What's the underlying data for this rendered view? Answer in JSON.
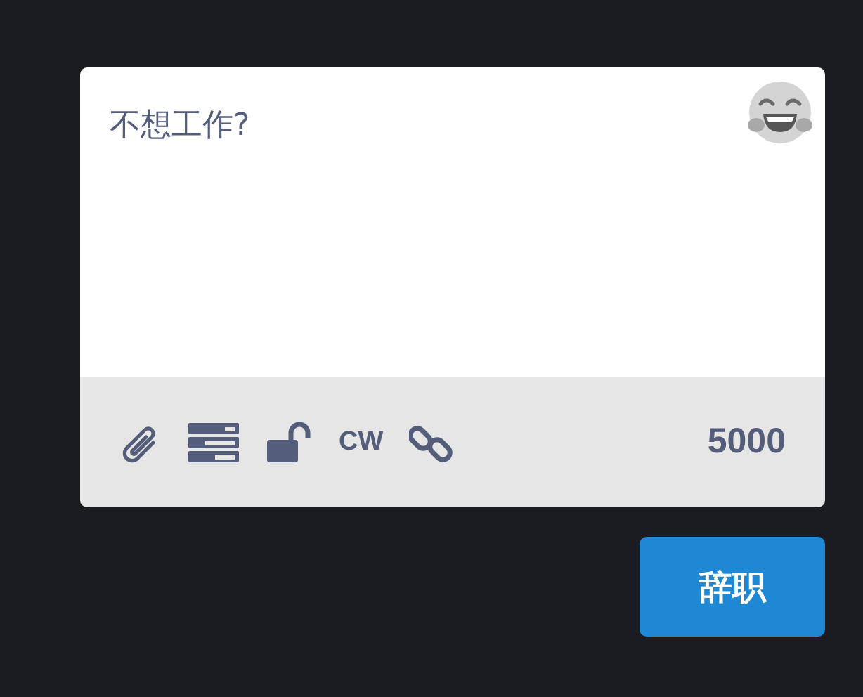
{
  "compose": {
    "placeholder": "不想工作?",
    "cw_label": "CW",
    "char_counter": "5000"
  },
  "submit_button": "辞职"
}
